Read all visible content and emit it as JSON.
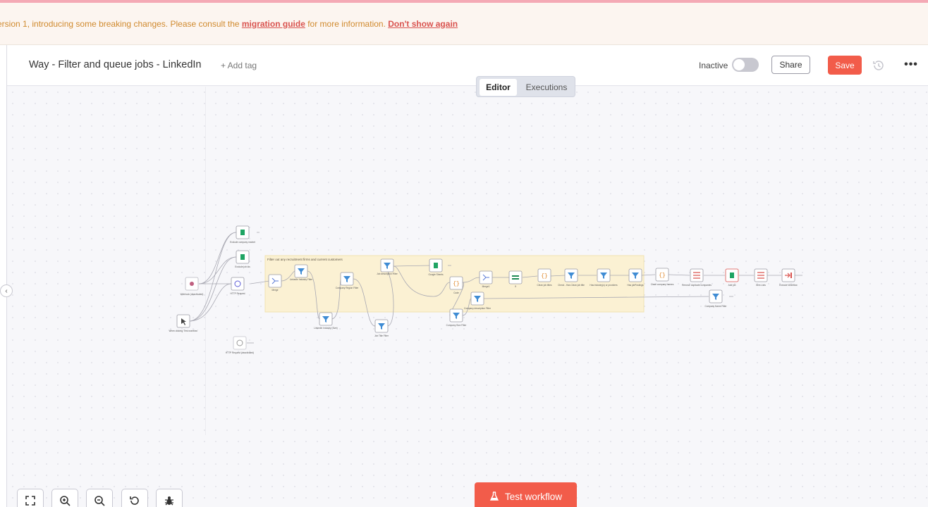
{
  "banner": {
    "text": "ersion 1, introducing some breaking changes. Please consult the ",
    "link": "migration guide",
    "after": " for more information. ",
    "dismiss": "Don't show again"
  },
  "header": {
    "workflow_name": "Way - Filter and queue jobs - LinkedIn",
    "add_tag": "+ Add tag",
    "status_label": "Inactive",
    "share": "Share",
    "save": "Save"
  },
  "tabs": {
    "editor": "Editor",
    "executions": "Executions"
  },
  "sticky_note": "Filter out any recruitment firms and current customers",
  "nodes": {
    "n_exclude_market": "Exclude company market",
    "n_exclude_jobs": "Exclude job ids",
    "n_webhook": "Webhook (deactivated)",
    "n_http": "HTTP Request",
    "n_manual": "When clicking 'Test workflow'",
    "n_http2": "HTTP Request (deactivated)",
    "n_merge": "Merge",
    "n_li_industry": "LinkedIn Industry Filter",
    "n_li_industry_b": "LinkedIn Industry (Size)",
    "n_size_filter": "Company Region Filter",
    "n_job_title": "Job Title Filter",
    "n_job_desc": "Job description Filter",
    "n_sheets": "Google Sheets",
    "n_code": "Code",
    "n_merge2": "Merge1",
    "n_company_size": "Company Size Filter",
    "n_company_desc": "Company description Filter",
    "n_if": "If",
    "n_clean_titles": "Clean job titles",
    "n_check_titles": "Check - Has Clean job title",
    "n_has_industry": "Has industry(s) or providers",
    "n_has_jobs": "Has jobPostings",
    "n_clean_names": "Clean company names",
    "n_remove_dupes": "Remove duplicate companies",
    "n_add_job": "Add job",
    "n_item_lists": "Item Lists",
    "n_execute": "Execute Workflow",
    "n_name_filter": "Company Name Filter"
  },
  "test_button": "Test workflow",
  "icons": {
    "history": "history-icon",
    "more": "more-horizontal-icon",
    "fit": "fit-view-icon",
    "zoom_in": "zoom-in-icon",
    "zoom_out": "zoom-out-icon",
    "reset": "reset-zoom-icon",
    "debug": "bug-icon",
    "flask": "flask-icon"
  },
  "colors": {
    "accent": "#f25c4a",
    "sticky": "#fbf1d3"
  }
}
